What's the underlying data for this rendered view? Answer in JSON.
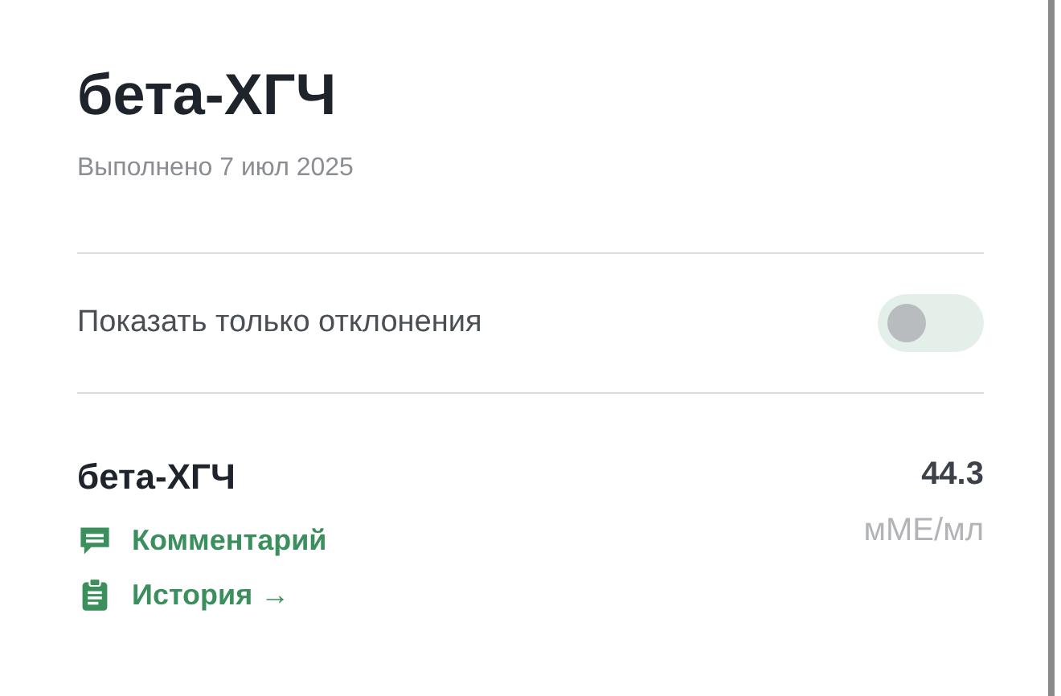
{
  "title": "бета-ХГЧ",
  "subtitle": "Выполнено 7 июл 2025",
  "filter": {
    "label": "Показать только отклонения",
    "on": false
  },
  "result": {
    "name": "бета-ХГЧ",
    "value": "44.3",
    "unit": "мМЕ/мл",
    "links": [
      {
        "kind": "comment",
        "label": "Комментарий"
      },
      {
        "kind": "history",
        "label": "История →"
      }
    ]
  }
}
